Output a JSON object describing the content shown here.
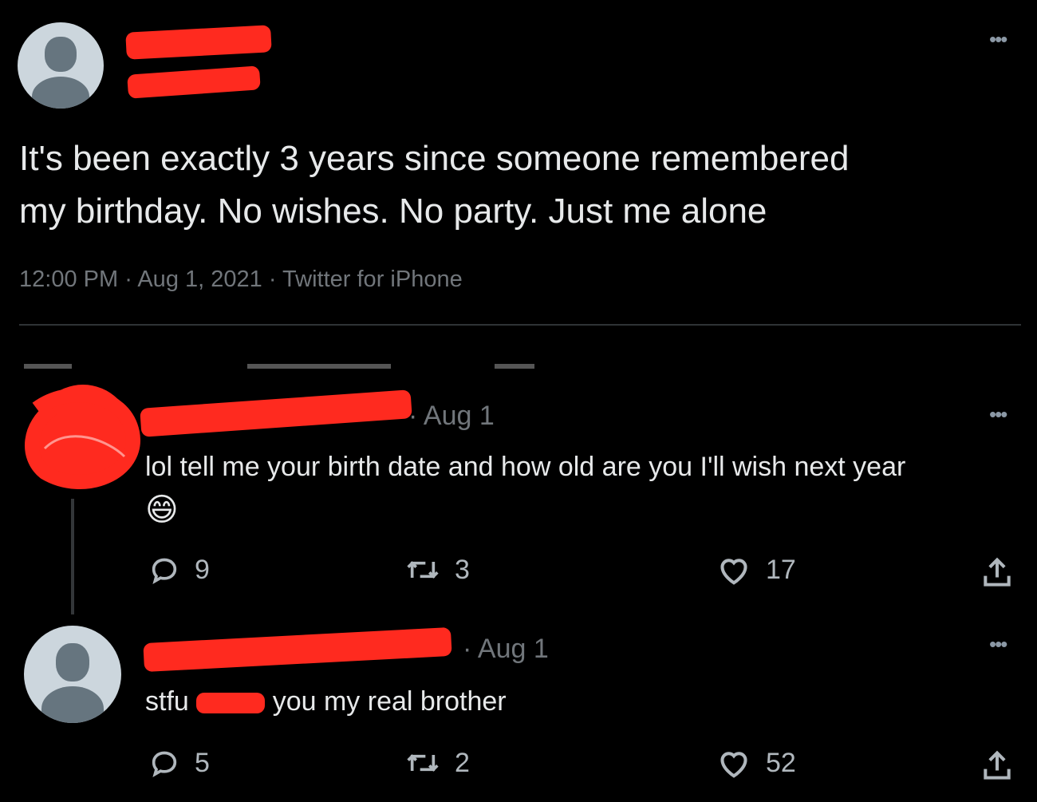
{
  "main_tweet": {
    "text_line1": "It's been exactly 3 years since someone remembered",
    "text_line2": "my birthday. No wishes. No party. Just me alone",
    "time": "12:00 PM",
    "date": "Aug 1, 2021",
    "source": "Twitter for iPhone",
    "separator": "·"
  },
  "reply1": {
    "date": "· Aug 1",
    "text": "lol tell me your birth date and how old are you I'll wish next year",
    "emoji": "😄",
    "replies": "9",
    "retweets": "3",
    "likes": "17"
  },
  "reply2": {
    "date": "· Aug 1",
    "text_before": "stfu",
    "text_after": "you my real brother",
    "replies": "5",
    "retweets": "2",
    "likes": "52"
  },
  "colors": {
    "background": "#000000",
    "text": "#e7e9ea",
    "muted": "#71767b",
    "redaction": "#ff2a1f"
  }
}
